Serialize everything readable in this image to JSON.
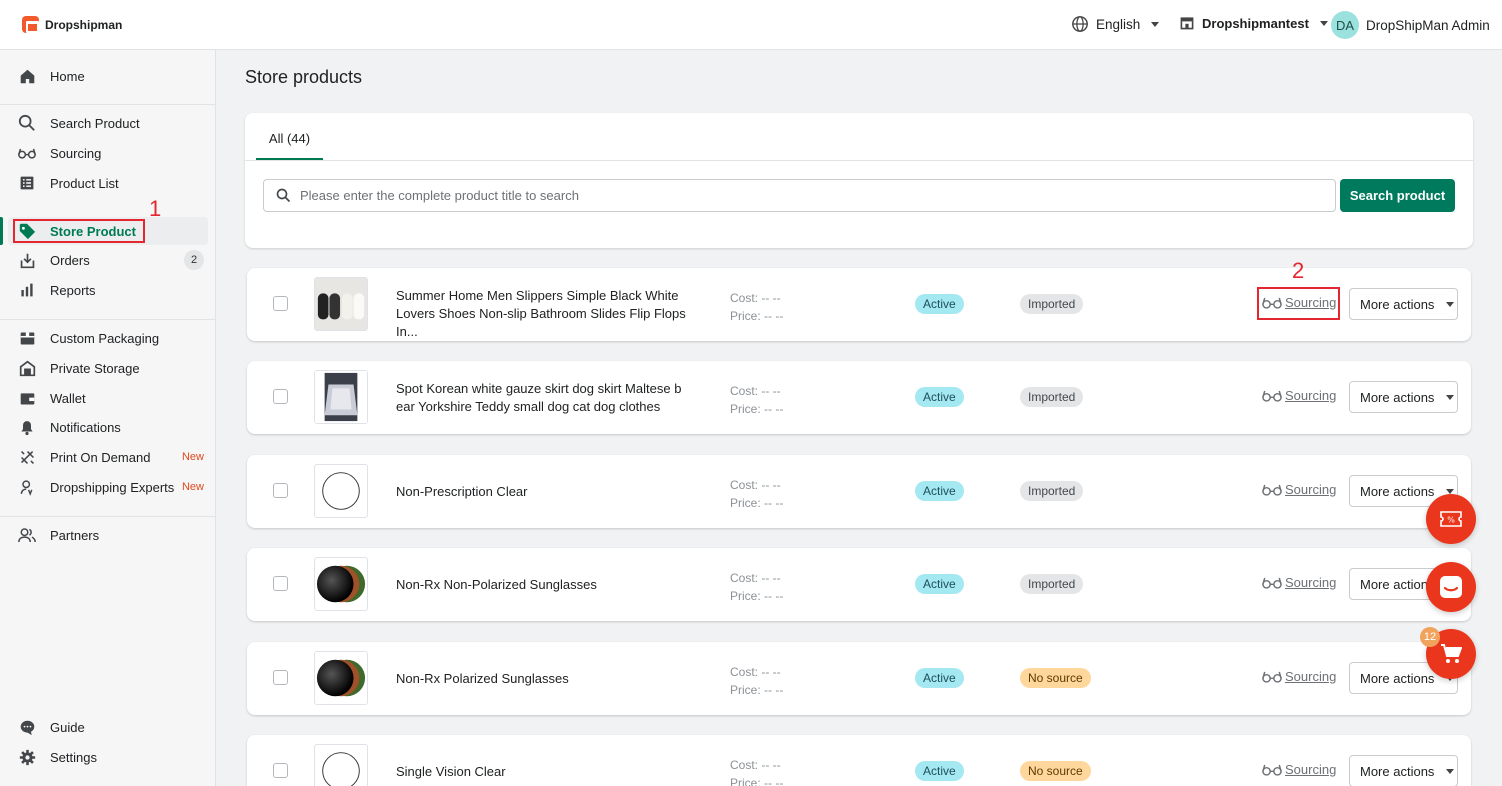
{
  "brand": {
    "name": "Dropshipman"
  },
  "header": {
    "language": "English",
    "store": "Dropshipmantest",
    "user_initials": "DA",
    "user_name": "DropShipMan Admin"
  },
  "sidebar": {
    "items": [
      {
        "label": "Home",
        "icon": "home-icon"
      },
      {
        "label": "Search Product",
        "icon": "search-icon"
      },
      {
        "label": "Sourcing",
        "icon": "glasses-icon"
      },
      {
        "label": "Product List",
        "icon": "list-icon"
      },
      {
        "label": "Store Product",
        "icon": "tag-icon",
        "active": true
      },
      {
        "label": "Orders",
        "icon": "orders-icon",
        "badge": "2"
      },
      {
        "label": "Reports",
        "icon": "reports-icon"
      },
      {
        "label": "Custom Packaging",
        "icon": "packaging-icon"
      },
      {
        "label": "Private Storage",
        "icon": "storage-icon"
      },
      {
        "label": "Wallet",
        "icon": "wallet-icon"
      },
      {
        "label": "Notifications",
        "icon": "bell-icon"
      },
      {
        "label": "Print On Demand",
        "icon": "print-icon",
        "tag": "New"
      },
      {
        "label": "Dropshipping Experts",
        "icon": "expert-icon",
        "tag": "New"
      },
      {
        "label": "Partners",
        "icon": "partners-icon"
      },
      {
        "label": "Guide",
        "icon": "guide-icon"
      },
      {
        "label": "Settings",
        "icon": "gear-icon"
      }
    ]
  },
  "annotations": {
    "one": "1",
    "two": "2"
  },
  "main": {
    "page_title": "Store products",
    "tab_all": "All (44)",
    "search_placeholder": "Please enter the complete product title to search",
    "search_button": "Search product"
  },
  "products": [
    {
      "title": "Summer Home Men Slippers Simple Black White Lovers Shoes Non-slip Bathroom Slides Flip Flops In...",
      "cost": "Cost: -- --",
      "price": "Price: -- --",
      "status": "Active",
      "source": "Imported",
      "sourcing": "Sourcing",
      "more": "More actions"
    },
    {
      "title": "Spot Korean white gauze skirt dog skirt Maltese bear Yorkshire Teddy small dog cat dog clothes",
      "cost": "Cost: -- --",
      "price": "Price: -- --",
      "status": "Active",
      "source": "Imported",
      "sourcing": "Sourcing",
      "more": "More actions"
    },
    {
      "title": "Non-Prescription Clear",
      "cost": "Cost: -- --",
      "price": "Price: -- --",
      "status": "Active",
      "source": "Imported",
      "sourcing": "Sourcing",
      "more": "More actions"
    },
    {
      "title": "Non-Rx Non-Polarized Sunglasses",
      "cost": "Cost: -- --",
      "price": "Price: -- --",
      "status": "Active",
      "source": "Imported",
      "sourcing": "Sourcing",
      "more": "More actions"
    },
    {
      "title": "Non-Rx Polarized Sunglasses",
      "cost": "Cost: -- --",
      "price": "Price: -- --",
      "status": "Active",
      "source": "No source",
      "sourcing": "Sourcing",
      "more": "More actions"
    },
    {
      "title": "Single Vision Clear",
      "cost": "Cost: -- --",
      "price": "Price: -- --",
      "status": "Active",
      "source": "No source",
      "sourcing": "Sourcing",
      "more": "More actions"
    }
  ],
  "floating": {
    "cart_count": "12"
  },
  "colors": {
    "accent": "#007a5c",
    "brand": "#f25a2b",
    "annotation": "#e3262f",
    "fab": "#e9361c"
  }
}
